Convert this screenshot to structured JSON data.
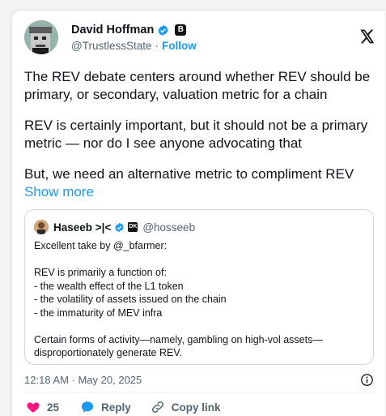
{
  "tweet": {
    "author": {
      "name": "David Hoffman",
      "handle": "@TrustlessState",
      "affiliate_badge": "B",
      "follow_label": "Follow",
      "dot": "·"
    },
    "paragraphs": [
      "The REV debate centers around whether REV should be primary, or secondary, valuation metric for a chain",
      "REV is certainly important, but it should not be a primary metric — nor do I see anyone advocating that"
    ],
    "last_paragraph": "But, we need an alternative metric to compliment REV",
    "show_more": "Show more",
    "quote": {
      "name": "Haseeb >|<",
      "handle": "@hosseeb",
      "affiliate_badge": "DK",
      "lines": [
        "Excellent take by @_bfarmer:",
        "",
        "REV is primarily a function of:",
        "- the wealth effect of the L1 token",
        "- the volatility of assets issued on the chain",
        "- the immaturity of MEV infra",
        "",
        "Certain forms of activity—namely, gambling on high-vol assets—",
        "disproportionately generate REV."
      ]
    },
    "timestamp": "12:18 AM · May 20, 2025",
    "actions": {
      "like_count": "25",
      "reply_label": "Reply",
      "copy_label": "Copy link"
    },
    "colors": {
      "accent": "#1d9bf0",
      "like": "#f91880",
      "muted": "#536471"
    },
    "icons": [
      "verified-icon",
      "x-logo-icon",
      "info-icon",
      "heart-icon",
      "reply-icon",
      "link-icon"
    ]
  }
}
